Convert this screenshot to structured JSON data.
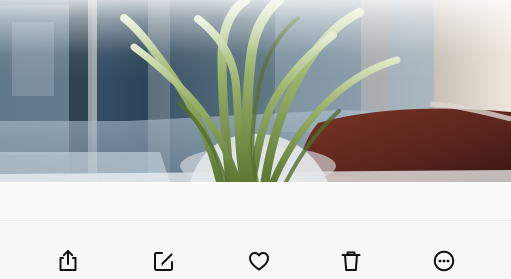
{
  "photo": {
    "subject": "potted-plant-by-window"
  },
  "toolbar": {
    "icons": [
      "share-icon",
      "edit-icon",
      "heart-icon",
      "trash-icon",
      "more-options-icon"
    ]
  },
  "colors": {
    "toolbar_background": "#f7f7f8",
    "icon_color": "#111111",
    "plant_green": "#6f8d43",
    "floor_brown": "#6b2f24"
  }
}
